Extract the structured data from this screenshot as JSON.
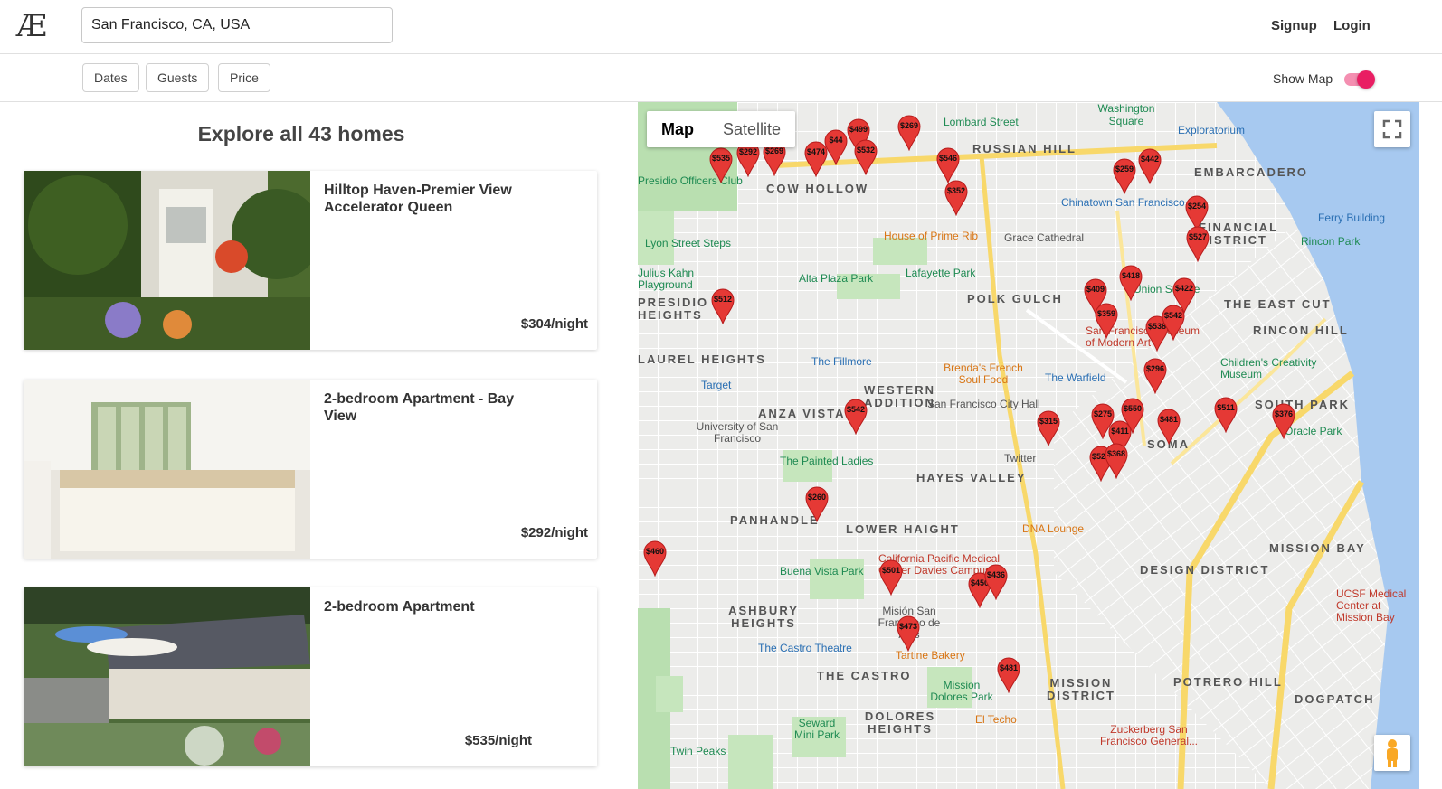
{
  "header": {
    "logo": "Æ",
    "search_value": "San Francisco, CA, USA",
    "signup": "Signup",
    "login": "Login"
  },
  "filters": {
    "dates": "Dates",
    "guests": "Guests",
    "price": "Price",
    "show_map": "Show Map",
    "show_map_on": true
  },
  "listings": {
    "title": "Explore all 43 homes",
    "items": [
      {
        "title": "Hilltop Haven-Premier View Accelerator Queen",
        "price": "$304/night"
      },
      {
        "title": "2-bedroom Apartment - Bay View",
        "price": "$292/night"
      },
      {
        "title": "2-bedroom Apartment",
        "price": "$535/night"
      }
    ]
  },
  "map": {
    "tabs": [
      "Map",
      "Satellite"
    ],
    "active_tab": "Map",
    "neighborhoods": [
      "RUSSIAN HILL",
      "COW HOLLOW",
      "EMBARCADERO",
      "FINANCIAL DISTRICT",
      "PRESIDIO HEIGHTS",
      "POLK GULCH",
      "THE EAST CUT",
      "RINCON HILL",
      "LAUREL HEIGHTS",
      "WESTERN ADDITION",
      "ANZA VISTA",
      "SOUTH PARK",
      "SOMA",
      "HAYES VALLEY",
      "PANHANDLE",
      "LOWER HAIGHT",
      "MISSION BAY",
      "DESIGN DISTRICT",
      "ASHBURY HEIGHTS",
      "THE CASTRO",
      "MISSION DISTRICT",
      "POTRERO HILL",
      "DOLORES HEIGHTS",
      "DOGPATCH"
    ],
    "places": [
      "Lombard Street",
      "Washington Square",
      "Exploratorium",
      "Presidio Officers Club",
      "Chinatown San Francisco",
      "Ferry Building",
      "Lyon Street Steps",
      "House of Prime Rib",
      "Grace Cathedral",
      "Rincon Park",
      "Julius Kahn Playground",
      "Alta Plaza Park",
      "Lafayette Park",
      "The Fillmore",
      "Brenda's French Soul Food",
      "The Warfield",
      "Children's Creativity Museum",
      "Target",
      "San Francisco City Hall",
      "University of San Francisco",
      "The Painted Ladies",
      "Twitter",
      "DNA Lounge",
      "California Pacific Medical Center Davies Campus",
      "Buena Vista Park",
      "Misión San Francisco de Asís",
      "The Castro Theatre",
      "Tartine Bakery",
      "Mission Dolores Park",
      "El Techo",
      "Seward Mini Park",
      "Zuckerberg San Francisco General...",
      "Twin Peaks",
      "UCSF Medical Center at Mission Bay",
      "San Francisco Museum of Modern Art",
      "Oracle Park",
      "Union Square"
    ],
    "markers": [
      "$535",
      "$292",
      "$269",
      "$474",
      "$44",
      "$499",
      "$532",
      "$269",
      "$546",
      "$352",
      "$259",
      "$442",
      "$254",
      "$527",
      "$512",
      "$409",
      "$418",
      "$422",
      "$359",
      "$538",
      "$542",
      "$296",
      "$542",
      "$315",
      "$275",
      "$550",
      "$481",
      "$411",
      "$511",
      "$376",
      "$527",
      "$368",
      "$260",
      "$460",
      "$501",
      "$450",
      "$436",
      "$473",
      "$481"
    ]
  }
}
